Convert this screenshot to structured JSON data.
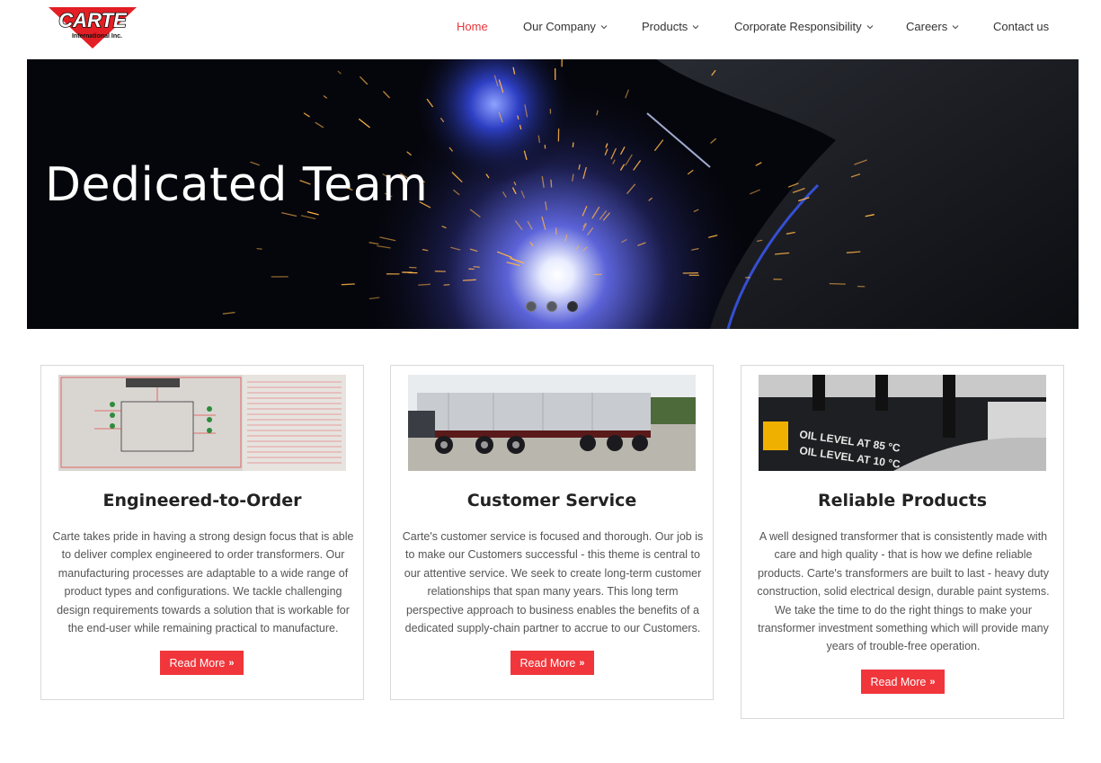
{
  "brand": {
    "logo_text": "CARTE",
    "logo_subtext": "International Inc.",
    "accent": "#e8343a"
  },
  "nav": {
    "items": [
      {
        "label": "Home",
        "active": true,
        "dropdown": false
      },
      {
        "label": "Our Company",
        "active": false,
        "dropdown": true
      },
      {
        "label": "Products",
        "active": false,
        "dropdown": true
      },
      {
        "label": "Corporate Responsibility",
        "active": false,
        "dropdown": true
      },
      {
        "label": "Careers",
        "active": false,
        "dropdown": true
      },
      {
        "label": "Contact us",
        "active": false,
        "dropdown": false
      }
    ]
  },
  "hero": {
    "title": "Dedicated Team",
    "slide_count": 3,
    "active_slide": 3
  },
  "cards": [
    {
      "title": "Engineered-to-Order",
      "text": "Carte takes pride in having a strong design focus that is able to deliver complex engineered to order transformers. Our manufacturing processes are adaptable to a wide range of product types and configurations. We tackle challenging design requirements towards a solution that is workable for the end-user while remaining practical to manufacture.",
      "button": "Read More"
    },
    {
      "title": "Customer Service",
      "text": "Carte's customer service is focused and thorough. Our job is to make our Customers successful - this theme is central to our attentive service. We seek to create long-term customer relationships that span many years. This long term perspective approach to business enables the benefits of a dedicated supply-chain partner to accrue to our Customers.",
      "button": "Read More"
    },
    {
      "title": "Reliable Products",
      "text": "A well designed transformer that is consistently made with care and high quality - that is how we define reliable products. Carte's transformers are built to last - heavy duty construction, solid electrical design, durable paint systems. We take the time to do the right things to make your transformer investment something which will provide many years of trouble-free operation.",
      "button": "Read More",
      "image_label_1": "OIL LEVEL AT 85 °C",
      "image_label_2": "OIL LEVEL AT 10 °C"
    }
  ]
}
